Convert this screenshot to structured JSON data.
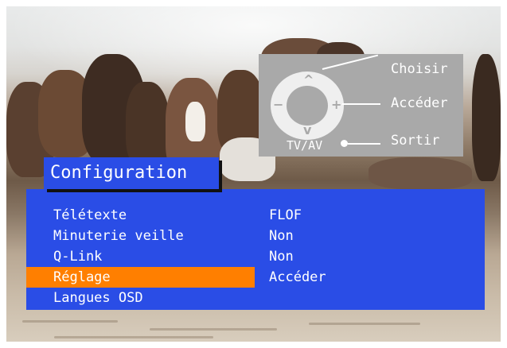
{
  "hints": {
    "choose": "Choisir",
    "enter": "Accéder",
    "exit": "Sortir",
    "tv_av": "TV/AV",
    "up_symbol": "^",
    "down_symbol": "v",
    "minus_symbol": "−",
    "plus_symbol": "+"
  },
  "menu": {
    "title": "Configuration",
    "items": [
      {
        "label": "Télétexte",
        "value": "FLOF"
      },
      {
        "label": "Minuterie veille",
        "value": "Non"
      },
      {
        "label": "Q-Link",
        "value": "Non"
      },
      {
        "label": "Réglage",
        "value": "Accéder",
        "selected": true
      },
      {
        "label": "Langues OSD",
        "value": ""
      }
    ]
  },
  "colors": {
    "menu_bg": "#2a4de6",
    "highlight": "#ff7f00",
    "hint_panel": "#a9a9a9",
    "text": "#ffffff"
  }
}
